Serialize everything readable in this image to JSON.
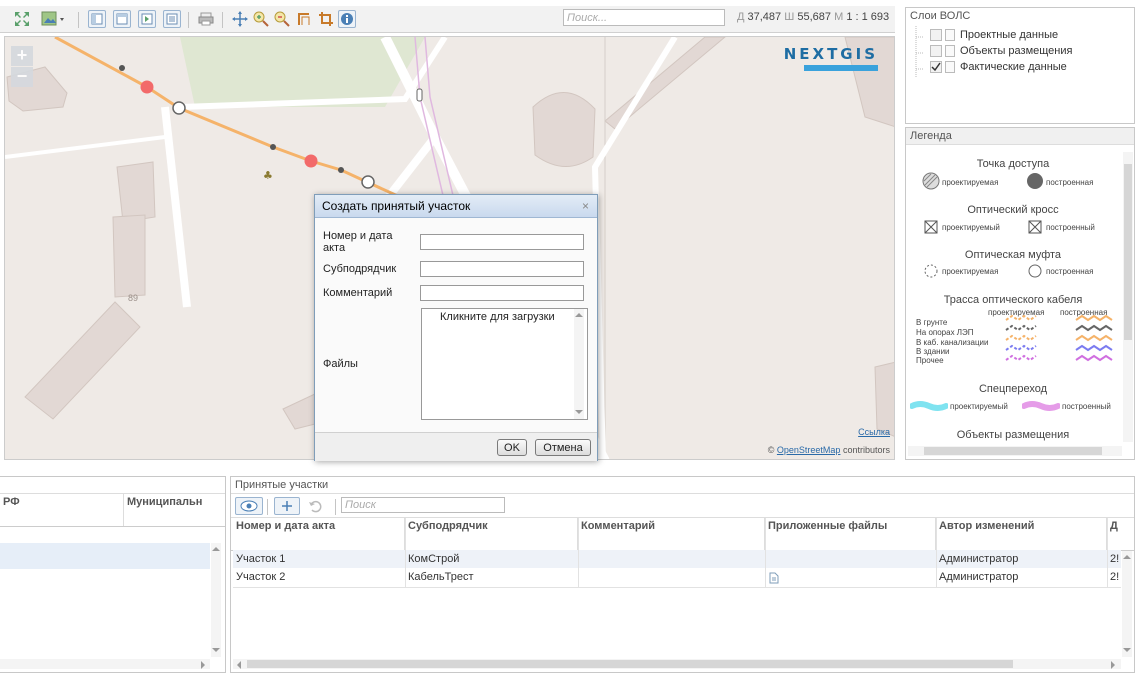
{
  "toolbar": {
    "search_placeholder": "Поиск...",
    "coords": {
      "d_label": "Д",
      "d_value": "37,487",
      "sh_label": "Ш",
      "sh_value": "55,687",
      "m_label": "М",
      "scale": "1 : 1 693"
    }
  },
  "map": {
    "zoom_in": "+",
    "zoom_out": "−",
    "logo": "NEXTGIS",
    "house_number": "89",
    "link_label": "Ссылка",
    "attribution_prefix": "©",
    "attribution_link": "OpenStreetMap",
    "attribution_suffix": "contributors"
  },
  "layers_panel": {
    "title": "Слои ВОЛС",
    "items": [
      {
        "label": "Проектные данные",
        "checked": false
      },
      {
        "label": "Объекты размещения",
        "checked": false
      },
      {
        "label": "Фактические данные",
        "checked": true
      }
    ]
  },
  "legend": {
    "title": "Легенда",
    "access_point": {
      "title": "Точка доступа",
      "planned": "проектируемая",
      "built": "построенная"
    },
    "cross": {
      "title": "Оптический кросс",
      "planned": "проектируемый",
      "built": "построенный"
    },
    "coupling": {
      "title": "Оптическая муфта",
      "planned": "проектируемая",
      "built": "построенная"
    },
    "route": {
      "title": "Трасса оптического кабеля",
      "planned": "проектируемая",
      "built": "построенная",
      "rows": [
        "В грунте",
        "На опорах ЛЭП",
        "В каб. канализации",
        "В здании",
        "Прочее"
      ]
    },
    "special": {
      "title": "Спецпереход",
      "planned": "проектируемый",
      "built": "построенный"
    },
    "placement": {
      "title": "Объекты размещения"
    }
  },
  "dialog": {
    "title": "Создать принятый участок",
    "close": "×",
    "fields": {
      "act_label": "Номер и дата акта",
      "contractor_label": "Субподрядчик",
      "comment_label": "Комментарий",
      "files_label": "Файлы",
      "upload_hint": "Кликните для загрузки"
    },
    "ok": "OK",
    "cancel": "Отмена"
  },
  "left_table": {
    "columns": [
      "РФ",
      "Муниципальн"
    ]
  },
  "accepted": {
    "title": "Принятые участки",
    "search_placeholder": "Поиск",
    "columns": [
      "Номер и дата акта",
      "Субподрядчик",
      "Комментарий",
      "Приложенные файлы",
      "Автор изменений",
      "Д"
    ],
    "rows": [
      {
        "act": "Участок 1",
        "contractor": "КомСтрой",
        "comment": "",
        "files": "",
        "author": "Администратор",
        "date": "2!"
      },
      {
        "act": "Участок 2",
        "contractor": "КабельТрест",
        "comment": "",
        "files": "file-icon",
        "author": "Администратор",
        "date": "2!"
      }
    ]
  },
  "colors": {
    "route": "#f5b36a",
    "access_point": "#f06060",
    "accent": "#1e6da3"
  }
}
